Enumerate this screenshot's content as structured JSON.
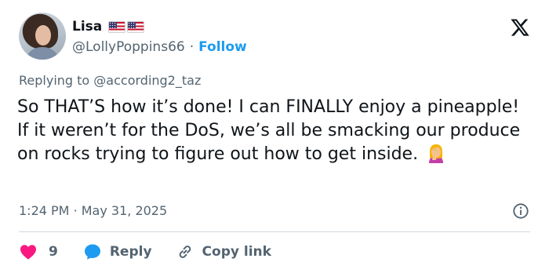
{
  "author": {
    "name": "Lisa",
    "handle": "@LollyPoppins66",
    "separator": "·",
    "follow_label": "Follow",
    "flags": [
      "us-flag",
      "us-flag"
    ]
  },
  "platform_icon": "x-logo-icon",
  "replying": {
    "prefix": "Replying to",
    "target": "@according2_taz"
  },
  "tweet": {
    "text": "So THAT’S how it’s done! I can FINALLY enjoy a pineapple! If it weren’t for the DoS, we’s all be smacking our produce on rocks trying to figure out how to get inside.",
    "emoji": "woman-facepalming-emoji"
  },
  "meta": {
    "time": "1:24 PM",
    "separator": "·",
    "date": "May 31, 2025"
  },
  "actions": {
    "like_count": "9",
    "reply_label": "Reply",
    "copy_label": "Copy link"
  },
  "colors": {
    "accent": "#1d9bf0",
    "like": "#f91880",
    "muted": "#536471",
    "text": "#0f1419",
    "divider": "#cfd9de"
  }
}
